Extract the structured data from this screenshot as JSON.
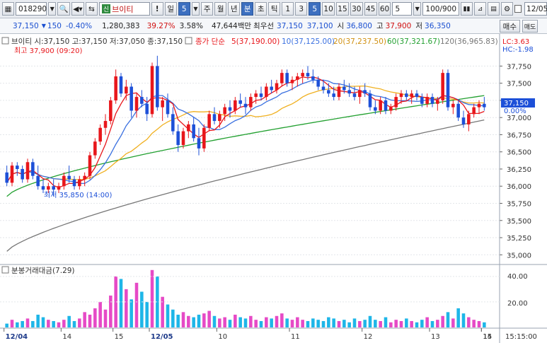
{
  "toolbar": {
    "code": "018290",
    "search_icon": "search-icon",
    "name_badge": "신",
    "name": "브이티",
    "bang": "!",
    "period_selected": "일",
    "period_num": "5",
    "periods": [
      "주",
      "월",
      "년",
      "분",
      "초",
      "틱"
    ],
    "minutes": [
      "1",
      "3",
      "5",
      "10",
      "15",
      "30",
      "45",
      "60"
    ],
    "minute_active": "5",
    "count": "5",
    "display": "100/900",
    "date": "12/05",
    "icons": [
      "candle-settings-icon",
      "ruler-icon",
      "save-icon",
      "gear-icon"
    ]
  },
  "quote": {
    "price": "37,150",
    "change_arrow": "▼",
    "change": "150",
    "change_pct": "-0.40%",
    "volume": "1,280,383",
    "turnover_pct": "39.27%",
    "ratio": "3.58%",
    "amount": "47,644백만",
    "best_ask_label": "최우선",
    "best_ask": "37,150",
    "best_bid": "37,100",
    "open_label": "시",
    "open": "36,800",
    "high_label": "고",
    "high": "37,900",
    "low_label": "저",
    "low": "36,350",
    "buy_label": "매수",
    "sell_label": "매도"
  },
  "chart_data": [
    {
      "type": "candlestick",
      "legend": {
        "ohlc": "브이티 시:37,150 고:37,150 저:37,050 종:37,150",
        "ma_type": "종가 단순",
        "ma5": "5(37,190.00)",
        "ma10": "10(37,125.00)",
        "ma20": "20(37,237.50)",
        "ma60": "60(37,321.67)",
        "ma120": "120(36,965.83)"
      },
      "lc": "LC:3.63",
      "hc": "HC:-1.98",
      "current_price": "37,150",
      "current_pct": "0.00%",
      "high_annotation": "최고 37,900 (09:20)",
      "low_annotation": "최저 35,850 (14:00)",
      "ylim": [
        34900,
        37950
      ],
      "y_ticks": [
        "37,750",
        "37,500",
        "37,250",
        "37,000",
        "36,750",
        "36,500",
        "36,250",
        "36,000",
        "35,750",
        "35,500",
        "35,250",
        "35,000"
      ],
      "x_labels": [
        "12/04",
        "14",
        "15",
        "12/05",
        "10",
        "11",
        "12",
        "13",
        "14",
        "15"
      ],
      "time_label": "15:15:00",
      "colors": {
        "up": "#e8161b",
        "down": "#1d50d8",
        "ma5": "#e8161b",
        "ma10": "#3a70e0",
        "ma20": "#f0b020",
        "ma60": "#22a030",
        "ma120": "#777777"
      },
      "candles": [
        [
          36200,
          36300,
          36000,
          36050
        ],
        [
          36050,
          36350,
          36000,
          36300
        ],
        [
          36300,
          36350,
          36150,
          36250
        ],
        [
          36250,
          36300,
          36050,
          36100
        ],
        [
          36100,
          36400,
          36050,
          36350
        ],
        [
          36350,
          36400,
          36100,
          36150
        ],
        [
          36150,
          36300,
          35950,
          36000
        ],
        [
          36000,
          36100,
          35900,
          35950
        ],
        [
          35950,
          36050,
          35900,
          36000
        ],
        [
          36000,
          36100,
          35850,
          35950
        ],
        [
          35950,
          36050,
          35900,
          36000
        ],
        [
          36000,
          36200,
          35950,
          36150
        ],
        [
          36150,
          36300,
          36050,
          36100
        ],
        [
          36100,
          36150,
          35950,
          36000
        ],
        [
          36000,
          36150,
          35950,
          36100
        ],
        [
          36100,
          36200,
          36000,
          36150
        ],
        [
          36150,
          36500,
          36100,
          36450
        ],
        [
          36450,
          36700,
          36400,
          36650
        ],
        [
          36650,
          36900,
          36600,
          36850
        ],
        [
          36850,
          37050,
          36750,
          36950
        ],
        [
          36950,
          37300,
          36900,
          37250
        ],
        [
          37250,
          37700,
          37200,
          37600
        ],
        [
          37600,
          37650,
          37300,
          37350
        ],
        [
          37350,
          37550,
          37250,
          37450
        ],
        [
          37450,
          37500,
          37000,
          37100
        ],
        [
          37100,
          37350,
          37000,
          37300
        ],
        [
          37300,
          37400,
          37150,
          37200
        ],
        [
          37200,
          37300,
          36950,
          37050
        ],
        [
          37050,
          37800,
          37000,
          37750
        ],
        [
          37750,
          37900,
          37100,
          37150
        ],
        [
          37150,
          37300,
          36950,
          37250
        ],
        [
          37250,
          37350,
          37000,
          37050
        ],
        [
          37050,
          37150,
          36750,
          36800
        ],
        [
          36800,
          36900,
          36500,
          36600
        ],
        [
          36600,
          36850,
          36550,
          36800
        ],
        [
          36800,
          36950,
          36700,
          36900
        ],
        [
          36900,
          37000,
          36650,
          36700
        ],
        [
          36700,
          36850,
          36450,
          36550
        ],
        [
          36550,
          36900,
          36500,
          36850
        ],
        [
          36850,
          37100,
          36800,
          37050
        ],
        [
          37050,
          37150,
          36900,
          36950
        ],
        [
          36950,
          37100,
          36850,
          37050
        ],
        [
          37050,
          37200,
          36950,
          37150
        ],
        [
          37150,
          37250,
          37000,
          37100
        ],
        [
          37100,
          37300,
          37050,
          37250
        ],
        [
          37250,
          37350,
          37150,
          37200
        ],
        [
          37200,
          37300,
          37050,
          37150
        ],
        [
          37150,
          37350,
          37100,
          37300
        ],
        [
          37300,
          37400,
          37200,
          37350
        ],
        [
          37350,
          37450,
          37250,
          37300
        ],
        [
          37300,
          37500,
          37250,
          37450
        ],
        [
          37450,
          37550,
          37350,
          37400
        ],
        [
          37400,
          37550,
          37350,
          37500
        ],
        [
          37500,
          37700,
          37450,
          37650
        ],
        [
          37650,
          37700,
          37450,
          37500
        ],
        [
          37500,
          37600,
          37400,
          37550
        ],
        [
          37550,
          37650,
          37450,
          37600
        ],
        [
          37600,
          37700,
          37500,
          37650
        ],
        [
          37650,
          37750,
          37550,
          37600
        ],
        [
          37600,
          37700,
          37500,
          37550
        ],
        [
          37550,
          37600,
          37400,
          37450
        ],
        [
          37450,
          37550,
          37350,
          37400
        ],
        [
          37400,
          37500,
          37300,
          37350
        ],
        [
          37350,
          37450,
          37250,
          37300
        ],
        [
          37300,
          37500,
          37250,
          37450
        ],
        [
          37450,
          37550,
          37350,
          37400
        ],
        [
          37400,
          37500,
          37300,
          37350
        ],
        [
          37350,
          37450,
          37250,
          37300
        ],
        [
          37300,
          37450,
          37200,
          37400
        ],
        [
          37400,
          37500,
          37300,
          37350
        ],
        [
          37350,
          37400,
          37100,
          37150
        ],
        [
          37150,
          37250,
          37050,
          37100
        ],
        [
          37100,
          37300,
          37050,
          37250
        ],
        [
          37250,
          37300,
          37050,
          37100
        ],
        [
          37100,
          37200,
          37050,
          37150
        ],
        [
          37150,
          37350,
          37100,
          37300
        ],
        [
          37300,
          37400,
          37200,
          37350
        ],
        [
          37350,
          37400,
          37250,
          37300
        ],
        [
          37300,
          37400,
          37200,
          37350
        ],
        [
          37350,
          37400,
          37250,
          37300
        ],
        [
          37300,
          37350,
          37150,
          37200
        ],
        [
          37200,
          37350,
          37150,
          37300
        ],
        [
          37300,
          37350,
          37150,
          37200
        ],
        [
          37200,
          37300,
          37100,
          37250
        ],
        [
          37250,
          37700,
          37200,
          37650
        ],
        [
          37650,
          37700,
          37100,
          37150
        ],
        [
          37150,
          37250,
          37050,
          37200
        ],
        [
          37200,
          37250,
          36950,
          37000
        ],
        [
          37000,
          37100,
          36850,
          36900
        ],
        [
          36900,
          37100,
          36800,
          37050
        ],
        [
          37050,
          37200,
          37000,
          37150
        ],
        [
          37150,
          37250,
          37050,
          37200
        ],
        [
          37200,
          37300,
          37100,
          37150
        ]
      ],
      "volume_panel": {
        "title": "분봉거래대금(7.29)",
        "y_ticks": [
          "40.00",
          "20.00"
        ],
        "ylim": [
          0,
          46
        ],
        "values": [
          3,
          6,
          4,
          5,
          7,
          5,
          10,
          8,
          6,
          5,
          4,
          6,
          9,
          5,
          7,
          12,
          10,
          15,
          20,
          14,
          25,
          40,
          38,
          30,
          22,
          35,
          28,
          20,
          45,
          40,
          24,
          18,
          14,
          10,
          12,
          9,
          8,
          10,
          11,
          13,
          9,
          7,
          8,
          6,
          10,
          8,
          7,
          9,
          6,
          5,
          8,
          7,
          9,
          11,
          7,
          6,
          8,
          6,
          5,
          7,
          6,
          5,
          8,
          7,
          5,
          6,
          4,
          7,
          5,
          6,
          9,
          6,
          5,
          8,
          4,
          6,
          5,
          7,
          5,
          4,
          6,
          8,
          5,
          6,
          9,
          12,
          7,
          15,
          11,
          8,
          6,
          5,
          4
        ]
      }
    }
  ]
}
